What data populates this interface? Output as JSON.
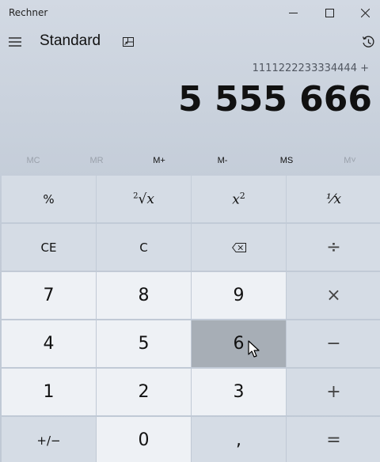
{
  "window": {
    "title": "Rechner",
    "controls": {
      "minimize": "minimize-icon",
      "maximize": "maximize-icon",
      "close": "close-icon"
    }
  },
  "header": {
    "menu_icon": "hamburger-icon",
    "mode": "Standard",
    "keep_on_top_icon": "keep-on-top-icon",
    "history_icon": "history-icon"
  },
  "display": {
    "expression": "1111222233334444 +",
    "value": "5 555 666"
  },
  "memory": {
    "mc": "MC",
    "mr": "MR",
    "m_plus": "M+",
    "m_minus": "M-",
    "ms": "MS",
    "m_list": "M˅"
  },
  "keys": {
    "percent": "%",
    "sqrt_index": "2",
    "sqrt_x": "x",
    "square_x": "x",
    "square_exp": "2",
    "reciprocal": "⅟x",
    "ce": "CE",
    "c": "C",
    "backspace_icon": "backspace-icon",
    "divide": "÷",
    "seven": "7",
    "eight": "8",
    "nine": "9",
    "multiply": "×",
    "four": "4",
    "five": "5",
    "six": "6",
    "minus": "−",
    "one": "1",
    "two": "2",
    "three": "3",
    "plus": "+",
    "negate": "+/−",
    "zero": "0",
    "decimal": ",",
    "equals": "="
  },
  "colors": {
    "background": "#c8d0db",
    "number_key": "#eef1f5",
    "operator_key": "#d5dce5",
    "pressed_key": "#a7aeb6"
  }
}
